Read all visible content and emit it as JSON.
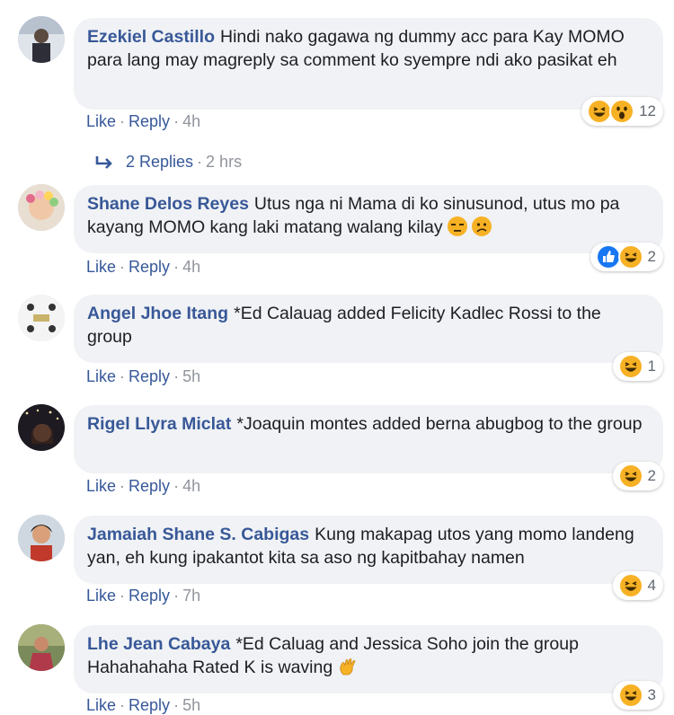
{
  "comments": [
    {
      "author": "Ezekiel Castillo",
      "text": "Hindi nako gagawa ng dummy acc para Kay MOMO para lang may magreply sa comment ko syempre ndi ako pasikat eh",
      "like": "Like",
      "reply": "Reply",
      "time": "4h",
      "reactions": [
        "haha-icon",
        "wow-icon"
      ],
      "reaction_count": "12"
    },
    {
      "author": "Shane Delos Reyes",
      "text": "Utus nga ni Mama di ko sinusunod, utus mo pa kayang MOMO kang laki matang walang kilay",
      "like": "Like",
      "reply": "Reply",
      "time": "4h",
      "reactions": [
        "like-icon",
        "haha-icon"
      ],
      "reaction_count": "2"
    },
    {
      "author": "Angel Jhoe Itang",
      "text": "*Ed Calauag added Felicity Kadlec Rossi to the group",
      "like": "Like",
      "reply": "Reply",
      "time": "5h",
      "reactions": [
        "haha-icon"
      ],
      "reaction_count": "1"
    },
    {
      "author": "Rigel Llyra Miclat",
      "text": "*Joaquin montes added berna abugbog to the group",
      "like": "Like",
      "reply": "Reply",
      "time": "4h",
      "reactions": [
        "haha-icon"
      ],
      "reaction_count": "2"
    },
    {
      "author": "Jamaiah Shane S. Cabigas",
      "text": "Kung makapag utos yang momo landeng yan, eh kung ipakantot kita sa aso ng kapitbahay namen",
      "like": "Like",
      "reply": "Reply",
      "time": "7h",
      "reactions": [
        "haha-icon"
      ],
      "reaction_count": "4"
    },
    {
      "author": "Lhe Jean Cabaya",
      "text": "*Ed Caluag and Jessica Soho join the group Hahahahaha Rated K is waving",
      "like": "Like",
      "reply": "Reply",
      "time": "5h",
      "reactions": [
        "haha-icon"
      ],
      "reaction_count": "3"
    }
  ],
  "replies": {
    "label": "2 Replies",
    "time": "2 hrs",
    "icon": "reply-arrow-icon"
  },
  "colors": {
    "author": "#385898",
    "link": "#365899",
    "bubble": "#f0f2f5",
    "muted": "#90949c",
    "like_blue": "#1877f2",
    "emoji_yellow": "#f7b125"
  }
}
